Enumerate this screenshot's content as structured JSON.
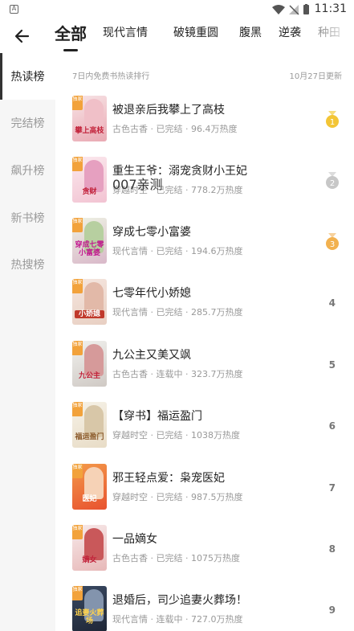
{
  "status": {
    "time": "11:31"
  },
  "tabs": [
    {
      "label": "全部",
      "active": true
    },
    {
      "label": "现代言情"
    },
    {
      "label": "破镜重圆"
    },
    {
      "label": "腹黑"
    },
    {
      "label": "逆袭"
    },
    {
      "label": "种田"
    }
  ],
  "sidebar": [
    {
      "label": "热读榜",
      "active": true
    },
    {
      "label": "完结榜"
    },
    {
      "label": "飙升榜"
    },
    {
      "label": "新书榜"
    },
    {
      "label": "热搜榜"
    }
  ],
  "ranking": {
    "subtitle": "7日内免费书热读排行",
    "date": "10月27日更新",
    "badge": "独家"
  },
  "overlay_text": "007亲测",
  "books": [
    {
      "rank": "1",
      "title": "被退亲后我攀上了高枝",
      "meta": "古色古香 · 已完结 · 96.4万热度",
      "cover_text": "攀上高枝",
      "medal": "gold"
    },
    {
      "rank": "2",
      "title": "重生王爷：溺宠贪财小王妃",
      "meta": "穿越时空 · 已完结 · 778.2万热度",
      "cover_text": "贪财",
      "medal": "silver"
    },
    {
      "rank": "3",
      "title": "穿成七零小富婆",
      "meta": "现代言情 · 已完结 · 194.6万热度",
      "cover_text": "穿成七零小富婆",
      "medal": "bronze"
    },
    {
      "rank": "4",
      "title": "七零年代小娇媳",
      "meta": "现代言情 · 已完结 · 285.7万热度",
      "cover_text": "小娇媳"
    },
    {
      "rank": "5",
      "title": "九公主又美又飒",
      "meta": "古色古香 · 连载中 · 323.7万热度",
      "cover_text": "九公主"
    },
    {
      "rank": "6",
      "title": "【穿书】福运盈门",
      "meta": "穿越时空 · 已完结 · 1038万热度",
      "cover_text": "福运盈门"
    },
    {
      "rank": "7",
      "title": "邪王轻点爱：枭宠医妃",
      "meta": "穿越时空 · 已完结 · 987.5万热度",
      "cover_text": "医妃"
    },
    {
      "rank": "8",
      "title": "一品嫡女",
      "meta": "古色古香 · 已完结 · 1075万热度",
      "cover_text": "嫡女"
    },
    {
      "rank": "9",
      "title": "退婚后，司少追妻火葬场！",
      "meta": "现代言情 · 连载中 · 727.0万热度",
      "cover_text": "追妻火葬场"
    }
  ],
  "colors": {
    "gold": "#f3c536",
    "silver": "#c7c7c7",
    "bronze": "#f2b14f",
    "badge": "#f2a23b"
  }
}
